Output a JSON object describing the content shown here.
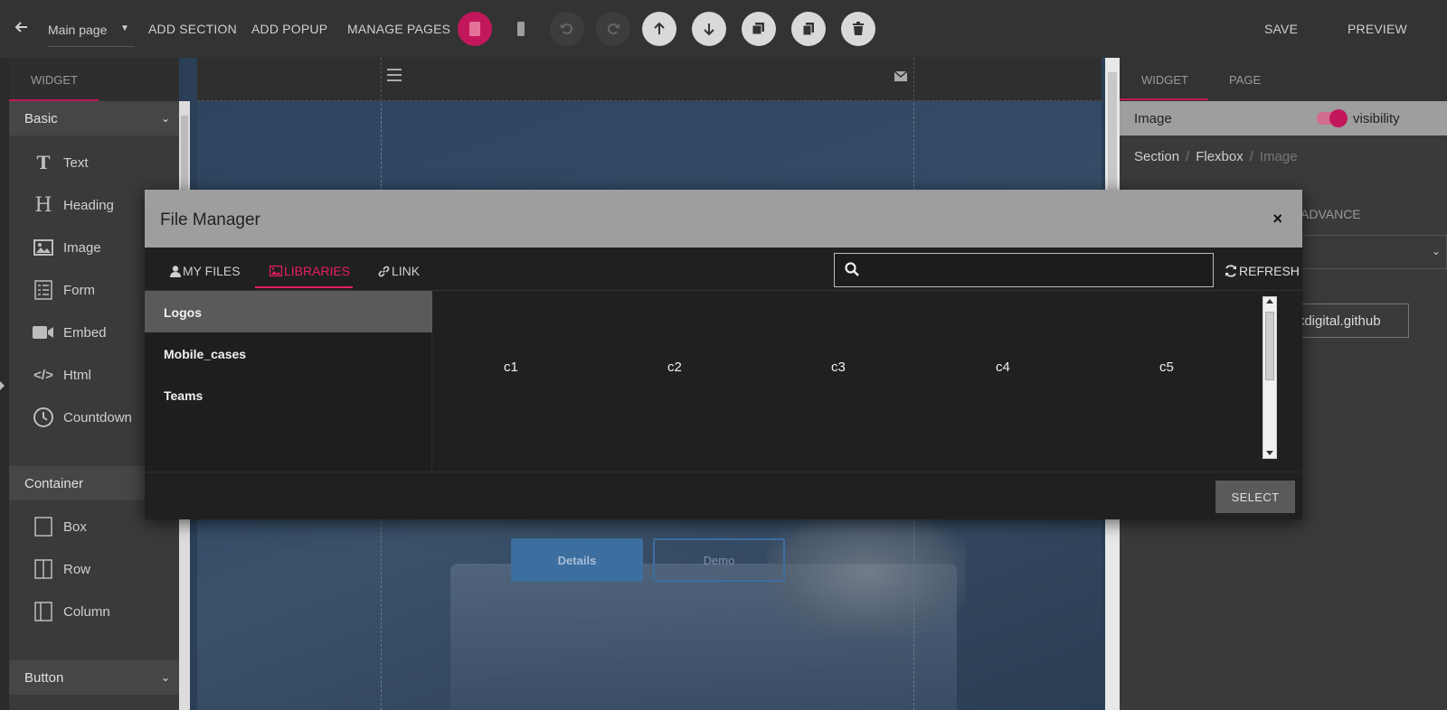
{
  "toolbar": {
    "page_select": "Main page",
    "add_section": "ADD SECTION",
    "add_popup": "ADD POPUP",
    "manage_pages": "MANAGE PAGES",
    "save": "SAVE",
    "preview": "PREVIEW",
    "accent_color": "#c2185b"
  },
  "left_panel": {
    "tab": "WIDGET",
    "basic_section": "Basic",
    "basic_items": [
      {
        "label": "Text",
        "icon": "text-icon"
      },
      {
        "label": "Heading",
        "icon": "heading-icon"
      },
      {
        "label": "Image",
        "icon": "image-icon"
      },
      {
        "label": "Form",
        "icon": "form-icon"
      },
      {
        "label": "Embed",
        "icon": "video-icon"
      },
      {
        "label": "Html",
        "icon": "code-icon"
      },
      {
        "label": "Countdown",
        "icon": "clock-icon"
      }
    ],
    "container_section": "Container",
    "container_items": [
      {
        "label": "Box",
        "icon": "box-icon"
      },
      {
        "label": "Row",
        "icon": "row-icon"
      },
      {
        "label": "Column",
        "icon": "column-icon"
      }
    ],
    "button_section": "Button"
  },
  "canvas": {
    "details_button": "Details",
    "demo_button": "Demo"
  },
  "right_panel": {
    "tab_widget": "WIDGET",
    "tab_page": "PAGE",
    "element_name": "Image",
    "visibility_label": "visibility",
    "breadcrumb": [
      "Section",
      "Flexbox",
      "Image"
    ],
    "advance_tab": "ADVANCE",
    "url_value": "ckrockdigital.github"
  },
  "file_manager": {
    "title": "File Manager",
    "close": "×",
    "tabs": {
      "my_files": "MY FILES",
      "libraries": "LIBRARIES",
      "link": "LINK"
    },
    "search_placeholder": "",
    "refresh": "REFRESH",
    "folders": [
      "Logos",
      "Mobile_cases",
      "Teams"
    ],
    "files": [
      "c1",
      "c2",
      "c3",
      "c4",
      "c5"
    ],
    "select_button": "SELECT"
  }
}
